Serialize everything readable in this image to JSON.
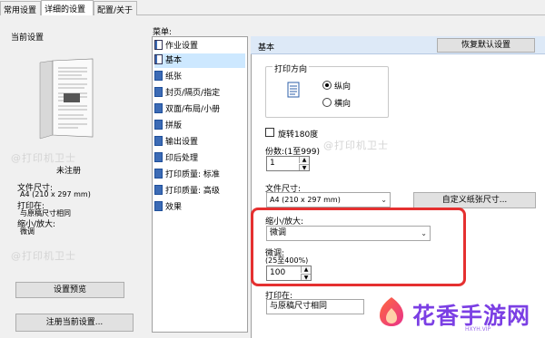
{
  "tabs": [
    {
      "label": "常用设置",
      "active": false
    },
    {
      "label": "详细的设置",
      "active": true
    },
    {
      "label": "配置/关于",
      "active": false
    }
  ],
  "left_panel": {
    "title": "当前设置",
    "unregistered": "未注册",
    "paper_size_label": "文件尺寸:",
    "paper_size_value": "A4 (210 x 297 mm)",
    "print_to_label": "打印在:",
    "print_to_value": "与原稿尺寸相同",
    "scale_label": "缩小/放大:",
    "scale_value": "微调",
    "preview_button": "设置预览",
    "register_button": "注册当前设置..."
  },
  "menu": {
    "title": "菜单:",
    "items": [
      {
        "label": "作业设置",
        "selected": false,
        "icon": "job-settings-icon"
      },
      {
        "label": "基本",
        "selected": true,
        "icon": "basic-icon"
      },
      {
        "label": "纸张",
        "selected": false,
        "icon": "paper-icon"
      },
      {
        "label": "封页/隔页/指定",
        "selected": false,
        "icon": "cover-icon"
      },
      {
        "label": "双面/布局/小册",
        "selected": false,
        "icon": "duplex-icon"
      },
      {
        "label": "拼版",
        "selected": false,
        "icon": "imposition-icon"
      },
      {
        "label": "输出设置",
        "selected": false,
        "icon": "output-icon"
      },
      {
        "label": "印后处理",
        "selected": false,
        "icon": "finishing-icon"
      },
      {
        "label": "打印质量: 标准",
        "selected": false,
        "icon": "quality-standard-icon"
      },
      {
        "label": "打印质量: 高级",
        "selected": false,
        "icon": "quality-advanced-icon"
      },
      {
        "label": "效果",
        "selected": false,
        "icon": "effects-icon"
      }
    ]
  },
  "content": {
    "header_title": "基本",
    "restore_defaults_button": "恢复默认设置",
    "orientation": {
      "title": "打印方向",
      "portrait": "纵向",
      "landscape": "横向",
      "selected": "portrait"
    },
    "rotate_180_label": "旋转180度",
    "copies_label": "份数:(1至999)",
    "copies_value": "1",
    "paper_size_label": "文件尺寸:",
    "paper_size_value": "A4 (210 x 297 mm)",
    "custom_size_button": "自定义纸张尺寸...",
    "scale_label": "缩小/放大:",
    "scale_value": "微调",
    "fine_tune_label": "微调:",
    "fine_tune_range": "(25至400%)",
    "fine_tune_value": "100",
    "print_on_label": "打印在:",
    "print_on_value": "与原稿尺寸相同"
  },
  "watermark": "@打印机卫士",
  "brand_logo_text": "花香手游网",
  "brand_url": "HXYH.VIP",
  "colors": {
    "highlight": "#e53030",
    "header_bg": "#dde9f7",
    "selected_item": "#cde8ff"
  }
}
